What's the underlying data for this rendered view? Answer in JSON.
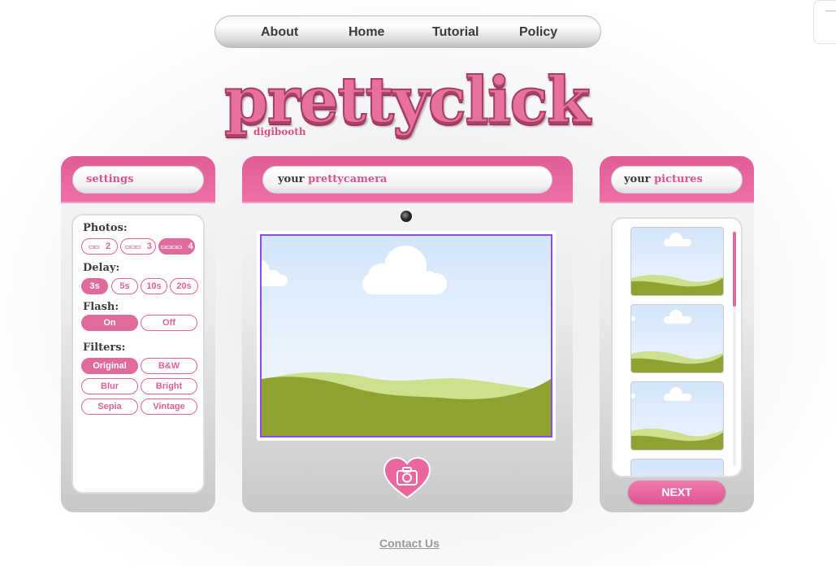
{
  "nav": {
    "links": [
      "About",
      "Home",
      "Tutorial",
      "Policy"
    ]
  },
  "logo": {
    "title": "prettyclick",
    "subtitle": "digibooth"
  },
  "settings": {
    "header": "settings",
    "photos_label": "Photos:",
    "photos_options": [
      "2",
      "3",
      "4"
    ],
    "photos_selected": "4",
    "delay_label": "Delay:",
    "delay_options": [
      "3s",
      "5s",
      "10s",
      "20s"
    ],
    "delay_selected": "3s",
    "flash_label": "Flash:",
    "flash_options": [
      "On",
      "Off"
    ],
    "flash_selected": "On",
    "filters_label": "Filters:",
    "filter_options": [
      "Original",
      "B&W",
      "Blur",
      "Bright",
      "Sepia",
      "Vintage"
    ],
    "filter_selected": "Original"
  },
  "camera": {
    "header_prefix": "your",
    "header_accent": "prettycamera",
    "shutter_icon": "camera-icon"
  },
  "pictures": {
    "header_prefix": "your",
    "header_accent": "pictures",
    "thumbnail_count": 4,
    "next_label": "NEXT"
  },
  "footer": {
    "contact": "Contact Us"
  },
  "colors": {
    "accent_pink": "#e06a9c",
    "viewport_border": "#8a4cf0",
    "hill_dark": "#8fa230",
    "hill_light": "#cde08e"
  }
}
